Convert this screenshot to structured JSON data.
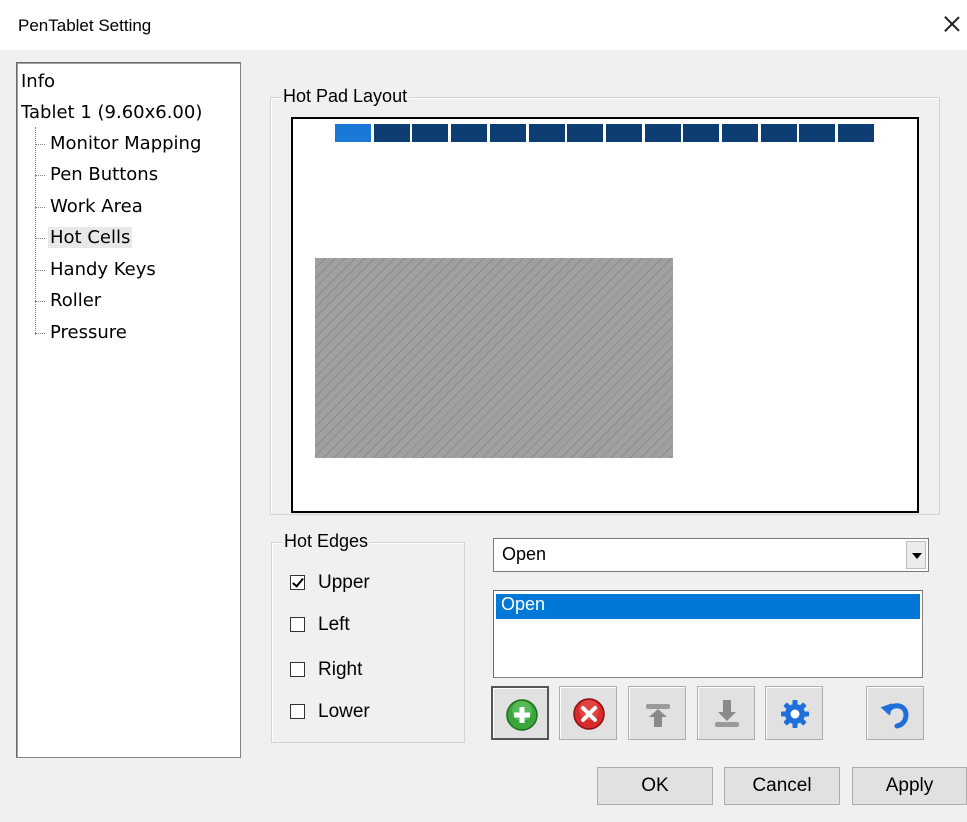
{
  "window": {
    "title": "PenTablet Setting"
  },
  "tree": {
    "root_items": [
      {
        "label": "Info"
      },
      {
        "label": "Tablet  1 (9.60x6.00)"
      }
    ],
    "children": [
      {
        "label": "Monitor Mapping"
      },
      {
        "label": "Pen Buttons"
      },
      {
        "label": "Work Area"
      },
      {
        "label": "Hot Cells"
      },
      {
        "label": "Handy Keys"
      },
      {
        "label": "Roller"
      },
      {
        "label": "Pressure"
      }
    ],
    "selected": "Hot Cells"
  },
  "hot_pad": {
    "label": "Hot Pad Layout",
    "cell_count": 14,
    "active_cell": 1,
    "colors": {
      "active": "#1a78d6",
      "inactive": "#0d3d73"
    }
  },
  "hot_edges": {
    "label": "Hot Edges",
    "options": [
      {
        "label": "Upper",
        "checked": true
      },
      {
        "label": "Left",
        "checked": false
      },
      {
        "label": "Right",
        "checked": false
      },
      {
        "label": "Lower",
        "checked": false
      }
    ]
  },
  "action": {
    "combo_value": "Open",
    "list_items": [
      "Open"
    ],
    "toolbar": [
      "add-icon",
      "delete-icon",
      "move-up-icon",
      "move-down-icon",
      "settings-gear-icon",
      "undo-icon"
    ]
  },
  "buttons": {
    "ok": "OK",
    "cancel": "Cancel",
    "apply": "Apply"
  }
}
